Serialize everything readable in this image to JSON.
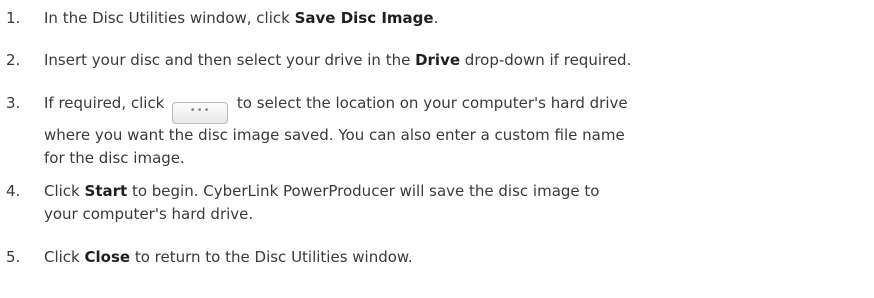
{
  "steps": [
    {
      "number": "1.",
      "lines": [
        [
          {
            "t": "In the Disc Utilities window, click "
          },
          {
            "t": "Save Disc Image",
            "b": true
          },
          {
            "t": "."
          }
        ]
      ]
    },
    {
      "number": "2.",
      "lines": [
        [
          {
            "t": "Insert your disc and then select your drive in the "
          },
          {
            "t": "Drive",
            "b": true
          },
          {
            "t": " drop-down if required."
          }
        ]
      ]
    },
    {
      "number": "3.",
      "lines": [
        [
          {
            "t": "If required, click "
          },
          {
            "btn": "•••"
          },
          {
            "t": " to select the location on your computer's hard drive"
          }
        ],
        [
          {
            "t": "where you want the disc image saved. You can also enter a custom file name"
          }
        ],
        [
          {
            "t": "for the disc image."
          }
        ]
      ]
    },
    {
      "number": "4.",
      "lines": [
        [
          {
            "t": "Click "
          },
          {
            "t": "Start",
            "b": true
          },
          {
            "t": " to begin. CyberLink PowerProducer will save the disc image to"
          }
        ],
        [
          {
            "t": "your computer's hard drive."
          }
        ]
      ]
    },
    {
      "number": "5.",
      "lines": [
        [
          {
            "t": "Click "
          },
          {
            "t": "Close",
            "b": true
          },
          {
            "t": " to return to the Disc Utilities window."
          }
        ]
      ]
    }
  ]
}
